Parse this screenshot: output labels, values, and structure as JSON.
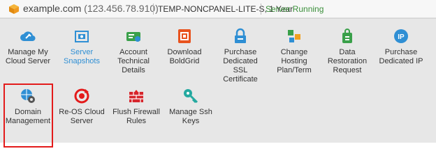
{
  "header": {
    "domain": "example.com",
    "ip": "(123.456.78.910)",
    "plan": "TEMP-NONCPANEL-LITE-S, 1 Year",
    "status": "Server Running"
  },
  "tiles_row1": [
    {
      "label": "Manage My\nCloud Server",
      "icon": "cloud-wrench-icon"
    },
    {
      "label": "Server\nSnapshots",
      "icon": "camera-icon"
    },
    {
      "label": "Account\nTechnical\nDetails",
      "icon": "id-card-icon"
    },
    {
      "label": "Download\nBoldGrid",
      "icon": "boldgrid-icon"
    },
    {
      "label": "Purchase\nDedicated\nSSL\nCertificate",
      "icon": "ssl-lock-icon"
    },
    {
      "label": "Change\nHosting\nPlan/Term",
      "icon": "cubes-icon"
    },
    {
      "label": "Data\nRestoration\nRequest",
      "icon": "database-lock-icon"
    },
    {
      "label": "Purchase\nDedicated IP",
      "icon": "ip-shield-icon"
    }
  ],
  "tiles_row2": [
    {
      "label": "Domain\nManagement",
      "icon": "globe-gear-icon"
    },
    {
      "label": "Re-OS Cloud\nServer",
      "icon": "reload-server-icon"
    },
    {
      "label": "Flush Firewall\nRules",
      "icon": "firewall-icon"
    },
    {
      "label": "Manage Ssh\nKeys",
      "icon": "keys-icon"
    }
  ],
  "colors": {
    "accent_blue": "#2f8fd4",
    "status_green": "#3a8f3a",
    "highlight_red": "#e31b1b",
    "panel_bg": "#e7e7e7",
    "brand_orange": "#f0a020"
  }
}
